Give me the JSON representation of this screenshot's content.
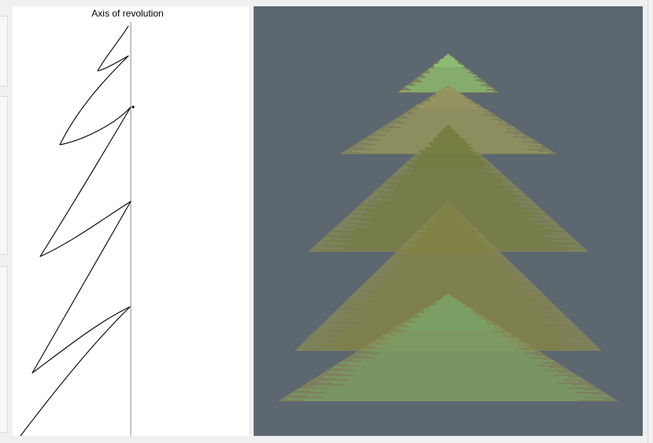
{
  "sketch": {
    "axis_label": "Axis of revolution"
  },
  "colors": {
    "window_bg": "#f0f0f0",
    "render_bg": "#5c6770",
    "stroke": "#000000",
    "axis_line": "#888888",
    "mesh_green": "#8fd47a",
    "mesh_purple": "#8f86c9",
    "mesh_olive": "#7d7f3e"
  }
}
